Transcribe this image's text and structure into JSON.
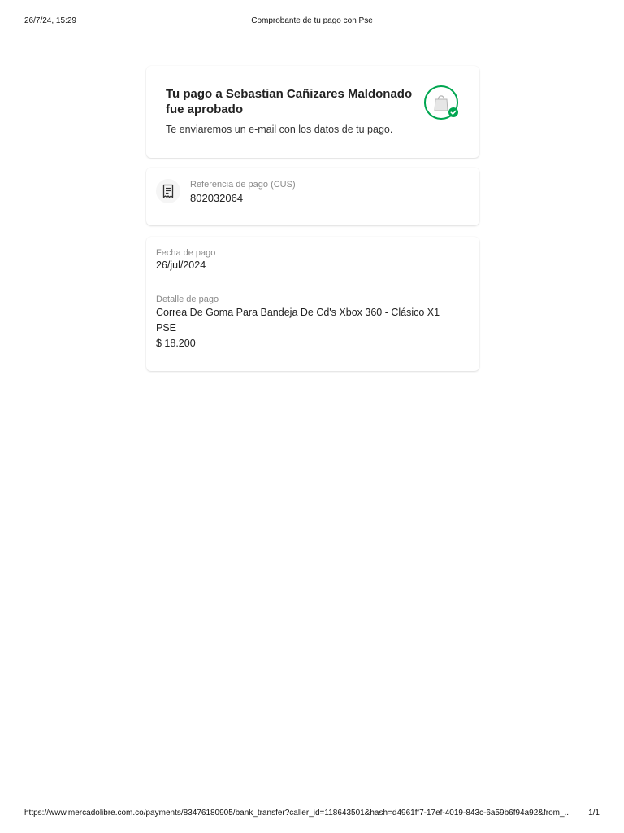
{
  "print_header": {
    "datetime": "26/7/24, 15:29",
    "title": "Comprobante de tu pago con Pse"
  },
  "status": {
    "title": "Tu pago a Sebastian Cañizares Maldonado fue aprobado",
    "subtitle": "Te enviaremos un e-mail con los datos de tu pago.",
    "icon": "shopping-bag-approved-icon",
    "accent_color": "#00a650"
  },
  "reference": {
    "icon": "receipt-icon",
    "label": "Referencia de pago (CUS)",
    "value": "802032064"
  },
  "details": {
    "date_label": "Fecha de pago",
    "date_value": "26/jul/2024",
    "detail_label": "Detalle de pago",
    "item": "Correa De Goma Para Bandeja De Cd's Xbox 360 - Clásico X1",
    "method": "PSE",
    "amount": "$ 18.200"
  },
  "print_footer": {
    "url": "https://www.mercadolibre.com.co/payments/83476180905/bank_transfer?caller_id=118643501&hash=d4961ff7-17ef-4019-843c-6a59b6f94a92&from_...",
    "page": "1/1"
  }
}
